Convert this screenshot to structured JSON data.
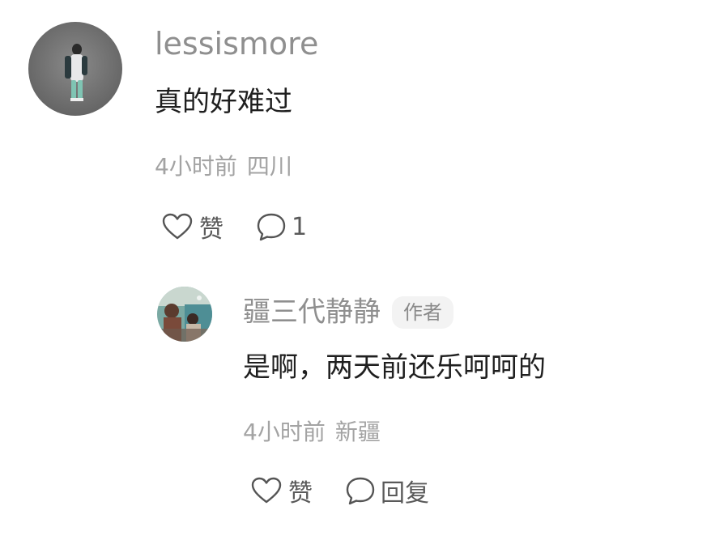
{
  "comment": {
    "username": "lessismore",
    "content": "真的好难过",
    "time": "4小时前",
    "location": "四川",
    "like_label": "赞",
    "reply_count": "1",
    "avatar_icon": "person-photo-avatar"
  },
  "reply": {
    "username": "疆三代静静",
    "author_badge": "作者",
    "content": "是啊，两天前还乐呵呵的",
    "time": "4小时前",
    "location": "新疆",
    "like_label": "赞",
    "reply_label": "回复",
    "avatar_icon": "group-photo-avatar"
  },
  "icons": {
    "like": "heart-outline-icon",
    "comment": "speech-bubble-icon"
  }
}
